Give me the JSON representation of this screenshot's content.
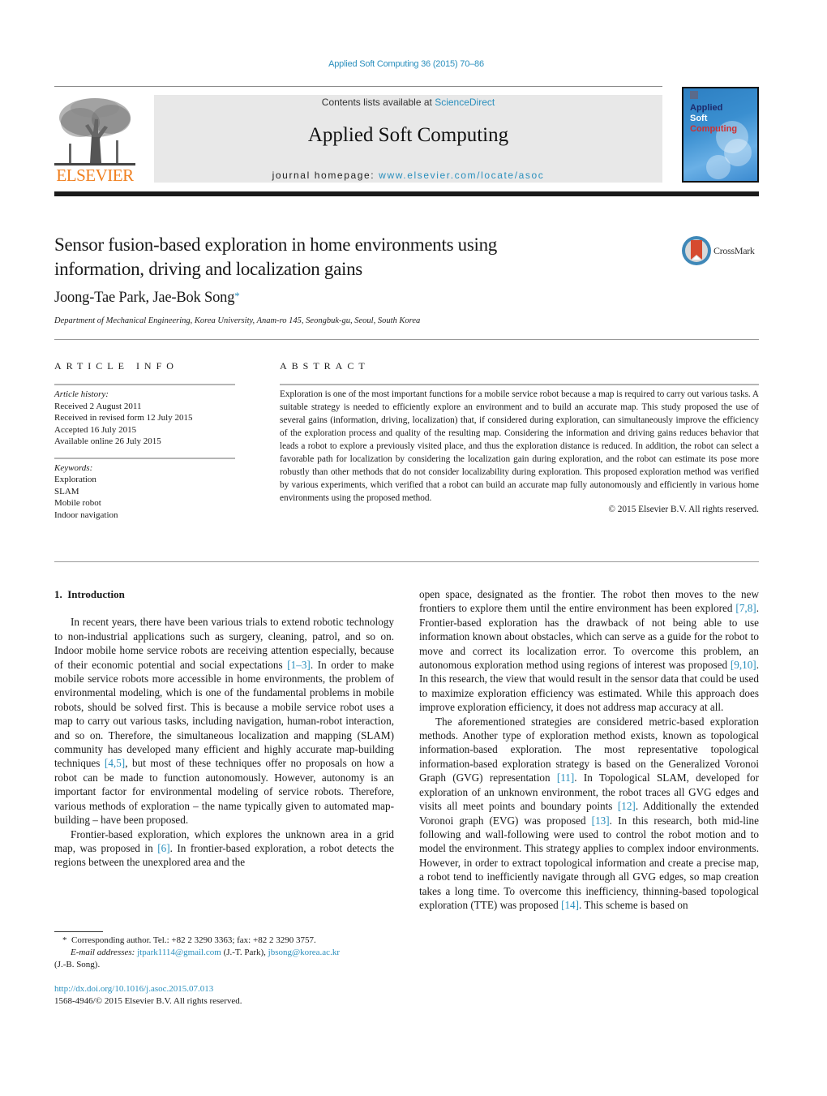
{
  "header": {
    "running_head": "Applied Soft Computing 36 (2015) 70–86",
    "publisher_logo_text": "ELSEVIER",
    "contents_prefix": "Contents lists available at ",
    "contents_link": "ScienceDirect",
    "journal_name": "Applied Soft Computing",
    "homepage_prefix": "journal homepage: ",
    "homepage_link": "www.elsevier.com/locate/asoc",
    "cover": {
      "line1": "Applied",
      "line2": "Soft",
      "line3": "Computing"
    },
    "colors": {
      "link": "#2a8fbd",
      "elsevier_orange": "#f07f1e",
      "cover_blue": "#3a8fd0"
    }
  },
  "article": {
    "title_line1": "Sensor fusion-based exploration in home environments using",
    "title_line2": "information, driving and localization gains",
    "crossmark_label": "CrossMark",
    "authors": "Joong-Tae Park, Jae-Bok Song",
    "author_mark": "*",
    "affiliation": "Department of Mechanical Engineering, Korea University, Anam-ro 145, Seongbuk-gu, Seoul, South Korea"
  },
  "article_info": {
    "heading": "ARTICLE INFO",
    "history_label": "Article history:",
    "history": [
      "Received 2 August 2011",
      "Received in revised form 12 July 2015",
      "Accepted 16 July 2015",
      "Available online 26 July 2015"
    ],
    "keywords_label": "Keywords:",
    "keywords": [
      "Exploration",
      "SLAM",
      "Mobile robot",
      "Indoor navigation"
    ]
  },
  "abstract": {
    "heading": "ABSTRACT",
    "text": "Exploration is one of the most important functions for a mobile service robot because a map is required to carry out various tasks. A suitable strategy is needed to efficiently explore an environment and to build an accurate map. This study proposed the use of several gains (information, driving, localization) that, if considered during exploration, can simultaneously improve the efficiency of the exploration process and quality of the resulting map. Considering the information and driving gains reduces behavior that leads a robot to explore a previously visited place, and thus the exploration distance is reduced. In addition, the robot can select a favorable path for localization by considering the localization gain during exploration, and the robot can estimate its pose more robustly than other methods that do not consider localizability during exploration. This proposed exploration method was verified by various experiments, which verified that a robot can build an accurate map fully autonomously and efficiently in various home environments using the proposed method.",
    "copyright": "© 2015 Elsevier B.V. All rights reserved."
  },
  "body": {
    "section_number": "1.",
    "section_title": "Introduction",
    "left": {
      "p1_a": "In recent years, there have been various trials to extend robotic technology to non-industrial applications such as surgery, cleaning, patrol, and so on. Indoor mobile home service robots are receiving attention especially, because of their economic potential and social expectations ",
      "p1_ref1": "[1–3]",
      "p1_b": ". In order to make mobile service robots more accessible in home environments, the problem of environmental modeling, which is one of the fundamental problems in mobile robots, should be solved first. This is because a mobile service robot uses a map to carry out various tasks, including navigation, human-robot interaction, and so on. Therefore, the simultaneous localization and mapping (SLAM) community has developed many efficient and highly accurate map-building techniques ",
      "p1_ref2": "[4,5]",
      "p1_c": ", but most of these techniques offer no proposals on how a robot can be made to function autonomously. However, autonomy is an important factor for environmental modeling of service robots. Therefore, various methods of exploration – the name typically given to automated map-building – have been proposed.",
      "p2_a": "Frontier-based exploration, which explores the unknown area in a grid map, was proposed in ",
      "p2_ref1": "[6]",
      "p2_b": ". In frontier-based exploration, a robot detects the regions between the unexplored area and the"
    },
    "right": {
      "p1_a": "open space, designated as the frontier. The robot then moves to the new frontiers to explore them until the entire environment has been explored ",
      "p1_ref1": "[7,8]",
      "p1_b": ". Frontier-based exploration has the drawback of not being able to use information known about obstacles, which can serve as a guide for the robot to move and correct its localization error. To overcome this problem, an autonomous exploration method using regions of interest was proposed ",
      "p1_ref2": "[9,10]",
      "p1_c": ". In this research, the view that would result in the sensor data that could be used to maximize exploration efficiency was estimated. While this approach does improve exploration efficiency, it does not address map accuracy at all.",
      "p2_a": "The aforementioned strategies are considered metric-based exploration methods. Another type of exploration method exists, known as topological information-based exploration. The most representative topological information-based exploration strategy is based on the Generalized Voronoi Graph (GVG) representation ",
      "p2_ref1": "[11]",
      "p2_b": ". In Topological SLAM, developed for exploration of an unknown environment, the robot traces all GVG edges and visits all meet points and boundary points ",
      "p2_ref2": "[12]",
      "p2_c": ". Additionally the extended Voronoi graph (EVG) was proposed ",
      "p2_ref3": "[13]",
      "p2_d": ". In this research, both mid-line following and wall-following were used to control the robot motion and to model the environment. This strategy applies to complex indoor environments. However, in order to extract topological information and create a precise map, a robot tend to inefficiently navigate through all GVG edges, so map creation takes a long time. To overcome this inefficiency, thinning-based topological exploration (TTE) was proposed ",
      "p2_ref4": "[14]",
      "p2_e": ". This scheme is based on"
    }
  },
  "footnote": {
    "mark": "*",
    "corresponding": "Corresponding author. Tel.: +82 2 3290 3363; fax: +82 2 3290 3757.",
    "email_label": "E-mail addresses:",
    "email1": "jtpark1114@gmail.com",
    "email1_name": " (J.-T. Park), ",
    "email2": "jbsong@korea.ac.kr",
    "email2_name": "(J.-B. Song)."
  },
  "doi": {
    "link": "http://dx.doi.org/10.1016/j.asoc.2015.07.013",
    "issn_line": "1568-4946/© 2015 Elsevier B.V. All rights reserved."
  }
}
